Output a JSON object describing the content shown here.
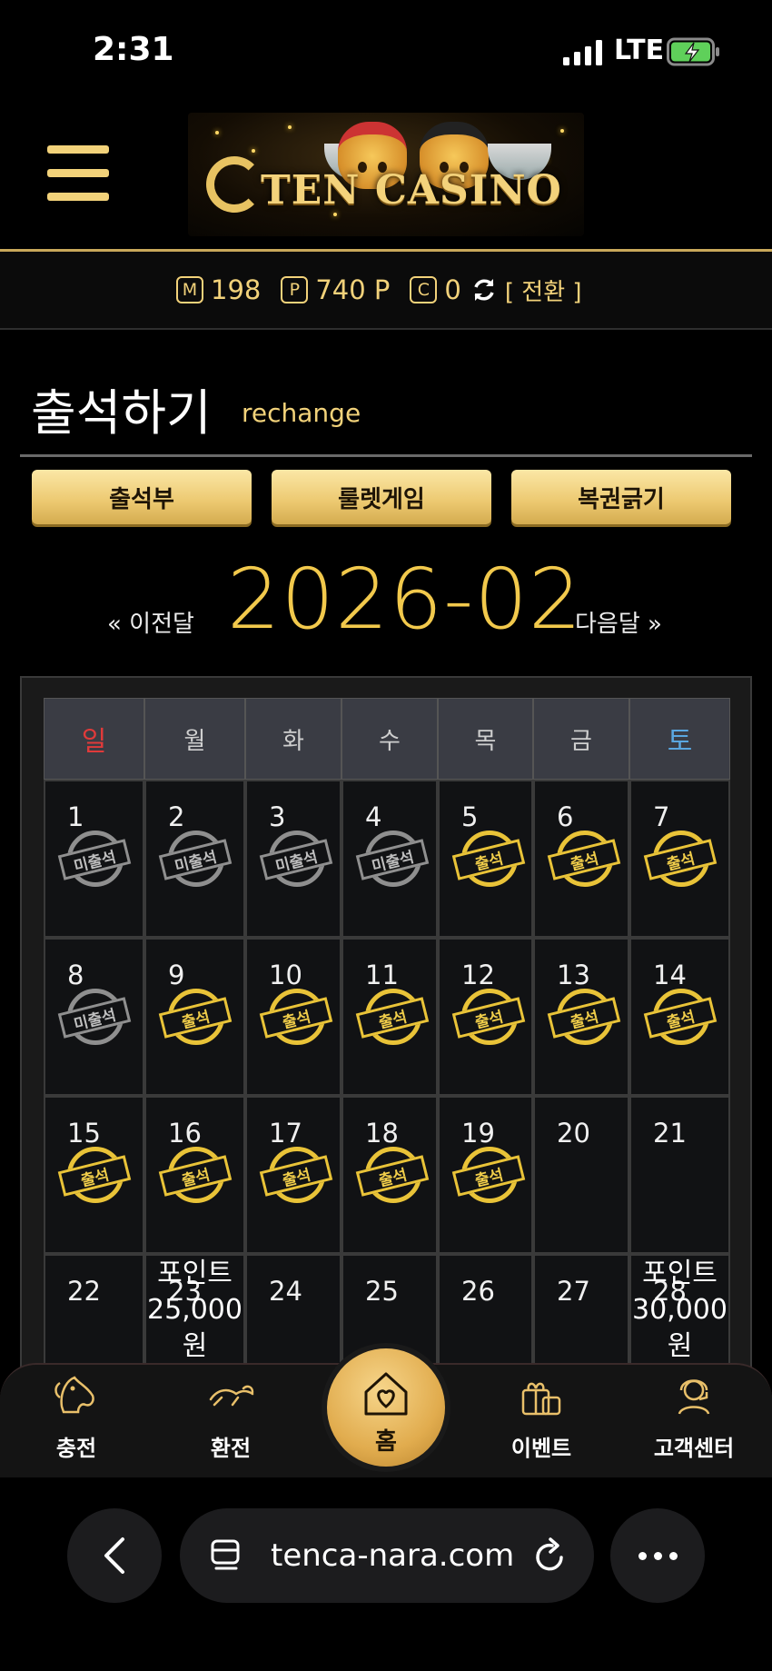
{
  "status": {
    "time": "2:31",
    "network": "LTE"
  },
  "header": {
    "logo_text": "TEN CASINO"
  },
  "points": {
    "m_badge": "M",
    "m_value": "198",
    "p_badge": "P",
    "p_value": "740 P",
    "c_badge": "C",
    "c_value": "0",
    "swap_label": "[ 전환 ]"
  },
  "page": {
    "title": "출석하기",
    "subtitle": "rechange"
  },
  "tabs": [
    "출석부",
    "룰렛게임",
    "복권긁기"
  ],
  "month_nav": {
    "prev": "« 이전달",
    "current": "2026-02",
    "next": "다음달 »"
  },
  "calendar": {
    "weekdays": [
      "일",
      "월",
      "화",
      "수",
      "목",
      "금",
      "토"
    ],
    "stamp_on_label": "출석",
    "stamp_off_label": "미출석",
    "weeks": [
      [
        {
          "d": "1",
          "s": "off"
        },
        {
          "d": "2",
          "s": "off"
        },
        {
          "d": "3",
          "s": "off"
        },
        {
          "d": "4",
          "s": "off"
        },
        {
          "d": "5",
          "s": "on"
        },
        {
          "d": "6",
          "s": "on"
        },
        {
          "d": "7",
          "s": "on"
        }
      ],
      [
        {
          "d": "8",
          "s": "off"
        },
        {
          "d": "9",
          "s": "on"
        },
        {
          "d": "10",
          "s": "on"
        },
        {
          "d": "11",
          "s": "on"
        },
        {
          "d": "12",
          "s": "on"
        },
        {
          "d": "13",
          "s": "on"
        },
        {
          "d": "14",
          "s": "on"
        }
      ],
      [
        {
          "d": "15",
          "s": "on"
        },
        {
          "d": "16",
          "s": "on"
        },
        {
          "d": "17",
          "s": "on"
        },
        {
          "d": "18",
          "s": "on"
        },
        {
          "d": "19",
          "s": "on"
        },
        {
          "d": "20",
          "s": ""
        },
        {
          "d": "21",
          "s": ""
        }
      ],
      [
        {
          "d": "22",
          "s": ""
        },
        {
          "d": "23",
          "s": "",
          "reward": "포인트 25,000 원"
        },
        {
          "d": "24",
          "s": ""
        },
        {
          "d": "25",
          "s": ""
        },
        {
          "d": "26",
          "s": ""
        },
        {
          "d": "27",
          "s": ""
        },
        {
          "d": "28",
          "s": "",
          "reward": "포인트 30,000 원"
        }
      ]
    ]
  },
  "bottom_nav": {
    "charge": "충전",
    "exchange": "환전",
    "home": "홈",
    "event": "이벤트",
    "support": "고객센터"
  },
  "browser": {
    "url": "tenca-nara.com"
  },
  "colors": {
    "gold": "#f2c94c",
    "background": "#000000",
    "sunday": "#e03a3a",
    "saturday": "#5aa7e0"
  }
}
